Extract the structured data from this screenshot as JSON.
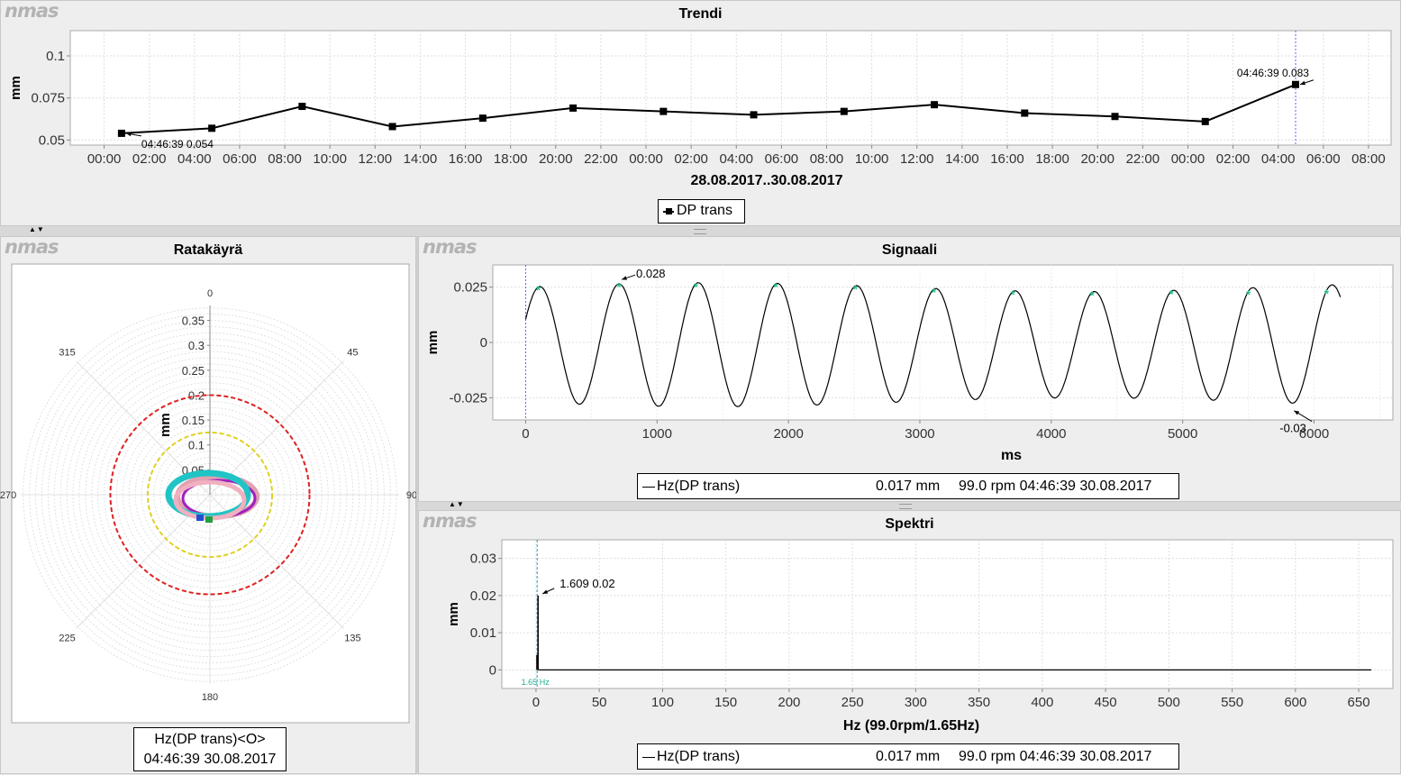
{
  "brand": "nmas",
  "trend": {
    "title": "Trendi",
    "ylabel": "mm",
    "xlabel": "28.08.2017..30.08.2017",
    "legend": "DP trans",
    "ann_first": "04:46:39 0.054",
    "ann_last": "04:46:39 0.083"
  },
  "orbit": {
    "title": "Ratakäyrä",
    "legend_line1": "Hz(DP trans)<O>",
    "legend_line2": "04:46:39 30.08.2017"
  },
  "signal": {
    "title": "Signaali",
    "legend_name": "Hz(DP trans)",
    "legend_value": "0.017 mm",
    "legend_meta": "99.0 rpm 04:46:39 30.08.2017"
  },
  "spectrum": {
    "title": "Spektri",
    "legend_name": "Hz(DP trans)",
    "legend_value": "0.017 mm",
    "legend_meta": "99.0 rpm 04:46:39 30.08.2017"
  },
  "chart_data": [
    {
      "type": "line",
      "title": "Trendi",
      "xlabel": "28.08.2017..30.08.2017",
      "ylabel": "mm",
      "x_ticks": [
        "00:00",
        "02:00",
        "04:00",
        "06:00",
        "08:00",
        "10:00",
        "12:00",
        "14:00",
        "16:00",
        "18:00",
        "20:00",
        "22:00",
        "00:00",
        "02:00",
        "04:00",
        "06:00",
        "08:00",
        "10:00",
        "12:00",
        "14:00",
        "16:00",
        "18:00",
        "20:00",
        "22:00",
        "00:00",
        "02:00",
        "04:00",
        "06:00",
        "08:00"
      ],
      "x_hours": [
        0.77,
        4.77,
        8.77,
        12.77,
        16.77,
        20.77,
        24.77,
        28.77,
        32.77,
        36.77,
        40.77,
        44.77,
        48.77,
        52.77
      ],
      "series": [
        {
          "name": "DP trans",
          "values": [
            0.054,
            0.057,
            0.07,
            0.058,
            0.063,
            0.069,
            0.067,
            0.065,
            0.067,
            0.071,
            0.066,
            0.064,
            0.061,
            0.083
          ]
        }
      ],
      "xlim": [
        -1.5,
        57
      ],
      "ylim": [
        0.047,
        0.115
      ],
      "y_ticks": [
        0.05,
        0.075,
        0.1
      ],
      "y_tick_labels": [
        "0.05",
        "0.075",
        "0.1"
      ],
      "annotations": [
        "04:46:39 0.054",
        "04:46:39 0.083"
      ],
      "grid": true,
      "legend": "bottom"
    },
    {
      "type": "polar",
      "title": "Ratakäyrä",
      "rlabel": "mm",
      "r_ticks": [
        0.05,
        0.1,
        0.15,
        0.2,
        0.25,
        0.3,
        0.35
      ],
      "r_tick_labels": [
        "0.05",
        "0.1",
        "0.15",
        "0.2",
        "0.25",
        "0.3",
        "0.35"
      ],
      "rmax": 0.38,
      "angle_labels": [
        "0",
        "45",
        "90",
        "135",
        "180",
        "225",
        "270",
        "315"
      ],
      "circles": [
        {
          "r": 0.2,
          "color": "#e02020"
        },
        {
          "r": 0.125,
          "color": "#e0d020"
        }
      ],
      "orbit_color": "#20c4c4"
    },
    {
      "type": "line",
      "title": "Signaali",
      "xlabel": "ms",
      "ylabel": "mm",
      "xlim": [
        -250,
        6600
      ],
      "ylim": [
        -0.035,
        0.035
      ],
      "x_ticks": [
        0,
        1000,
        2000,
        3000,
        4000,
        5000,
        6000
      ],
      "y_ticks": [
        -0.025,
        0,
        0.025
      ],
      "y_tick_labels": [
        "-0.025",
        "0",
        "0.025"
      ],
      "duration_ms": 6200,
      "period_ms": 603,
      "peak_ms": [
        96,
        710,
        1295,
        1903,
        2508,
        3107,
        3707,
        4310,
        4913,
        5500,
        6095
      ],
      "peak_labels": [
        {
          "ms": 710,
          "value": 0.028,
          "label": "0.028"
        },
        {
          "ms": 5820,
          "value": -0.03,
          "label": "-0.03"
        }
      ],
      "legend": "bottom"
    },
    {
      "type": "line",
      "title": "Spektri",
      "xlabel": "Hz  (99.0rpm/1.65Hz)",
      "ylabel": "mm",
      "xlim": [
        -27,
        677
      ],
      "ylim": [
        -0.005,
        0.035
      ],
      "x_ticks": [
        0,
        50,
        100,
        150,
        200,
        250,
        300,
        350,
        400,
        450,
        500,
        550,
        600,
        650
      ],
      "y_ticks": [
        0,
        0.01,
        0.02,
        0.03
      ],
      "y_tick_labels": [
        "0",
        "0.01",
        "0.02",
        "0.03"
      ],
      "peak": {
        "hz": 1.609,
        "value": 0.02,
        "label": "1.609 0.02"
      },
      "marker_label": "1.65 Hz",
      "x_end": 660,
      "legend": "bottom"
    }
  ]
}
